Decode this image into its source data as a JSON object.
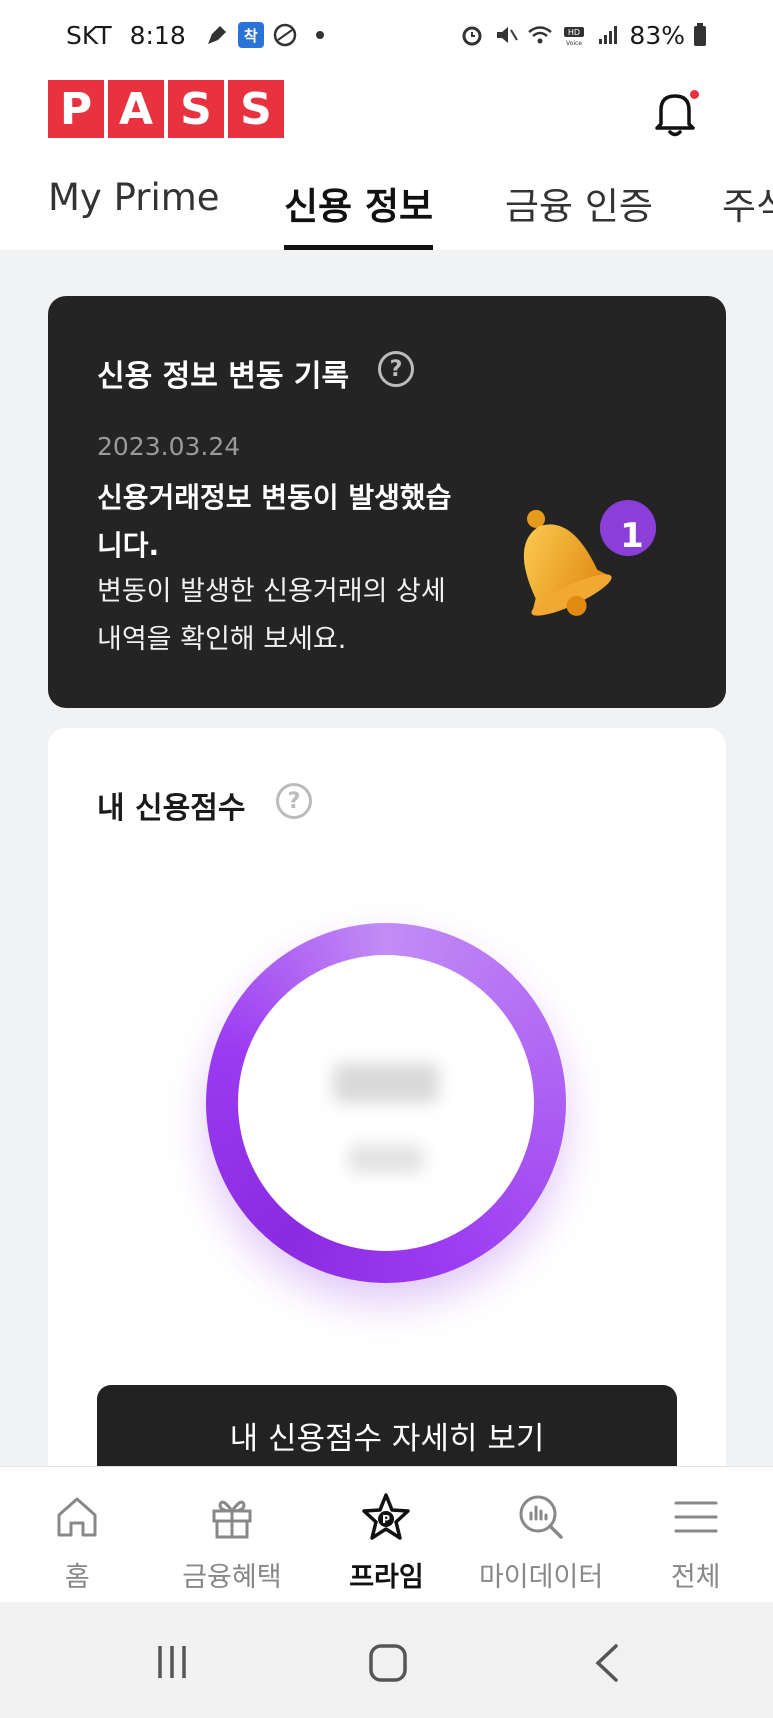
{
  "status_bar": {
    "carrier": "SKT",
    "time": "8:18",
    "battery": "83%"
  },
  "header": {
    "logo_letters": [
      "P",
      "A",
      "S",
      "S"
    ]
  },
  "tabs": [
    {
      "label": "My Prime",
      "active": false
    },
    {
      "label": "신용 정보",
      "active": true
    },
    {
      "label": "금융 인증",
      "active": false
    },
    {
      "label": "주식",
      "active": false
    }
  ],
  "credit_change": {
    "title": "신용 정보 변동 기록",
    "date": "2023.03.24",
    "headline": "신용거래정보 변동이 발생했습니다.",
    "description": "변동이 발생한 신용거래의 상세 내역을 확인해 보세요.",
    "badge_count": "1"
  },
  "credit_score": {
    "title": "내 신용점수",
    "detail_button": "내 신용점수 자세히 보기",
    "ring_color": "#9b3af1"
  },
  "bottom_nav": [
    {
      "label": "홈",
      "icon": "home-icon",
      "active": false
    },
    {
      "label": "금융혜택",
      "icon": "gift-icon",
      "active": false
    },
    {
      "label": "프라임",
      "icon": "prime-star-icon",
      "active": true
    },
    {
      "label": "마이데이터",
      "icon": "mydata-search-icon",
      "active": false
    },
    {
      "label": "전체",
      "icon": "menu-icon",
      "active": false
    }
  ],
  "colors": {
    "brand_red": "#e8323f",
    "dark_card": "#242424",
    "accent_purple": "#9b3af1"
  }
}
